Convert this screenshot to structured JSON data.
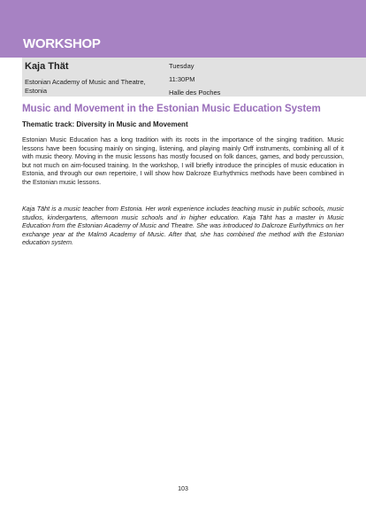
{
  "header": {
    "section_label": "WORKSHOP"
  },
  "info": {
    "speaker": "Kaja Thät",
    "affiliation": "Estonian Academy of Music and Theatre, Estonia",
    "day": "Tuesday",
    "time": "11:30PM",
    "venue": "Halle des Poches"
  },
  "session": {
    "title": "Music and Movement in the Estonian Music Education System",
    "track": "Thematic track: Diversity in Music and Movement",
    "abstract": "Estonian Music Education has a long tradition with its roots in the importance of the singing tradition. Music lessons have been focusing mainly on singing, listening, and playing mainly Orff instruments, combining all of it with music theory. Moving in the music lessons has mostly focused on folk dances, games, and body percussion, but not much on aim-focused training. In the workshop, I will briefly introduce the principles of music education in Estonia, and through our own repertoire, I will show how Dalcroze Eurhythmics methods have been combined in the Estonian music lessons.",
    "bio": "Kaja Tāht is a music teacher from Estonia. Her work experience includes teaching music in public schools, music studios, kindergartens, afternoon music schools and in higher education. Kaja Tāht has a master in Music Education from the Estonian Academy of Music and Theatre. She was introduced to Dalcroze Eurhythmics on her exchange year at the Malmö Academy of Music. After that, she has combined the method with the Estonian education system."
  },
  "footer": {
    "page_number": "103"
  }
}
